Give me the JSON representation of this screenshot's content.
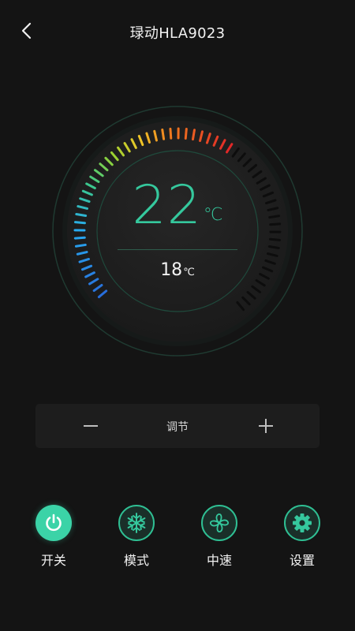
{
  "header": {
    "title": "琭动HLA9023"
  },
  "thermostat": {
    "current_temp": "22",
    "current_unit": "℃",
    "set_temp": "18",
    "set_unit": "℃",
    "accent_color": "#35c89d"
  },
  "adjust": {
    "label": "调节"
  },
  "controls": [
    {
      "label": "开关",
      "icon": "power-icon",
      "active": true
    },
    {
      "label": "模式",
      "icon": "snowflake-icon",
      "active": false
    },
    {
      "label": "中速",
      "icon": "fan-icon",
      "active": false
    },
    {
      "label": "设置",
      "icon": "gear-icon",
      "active": false
    }
  ]
}
